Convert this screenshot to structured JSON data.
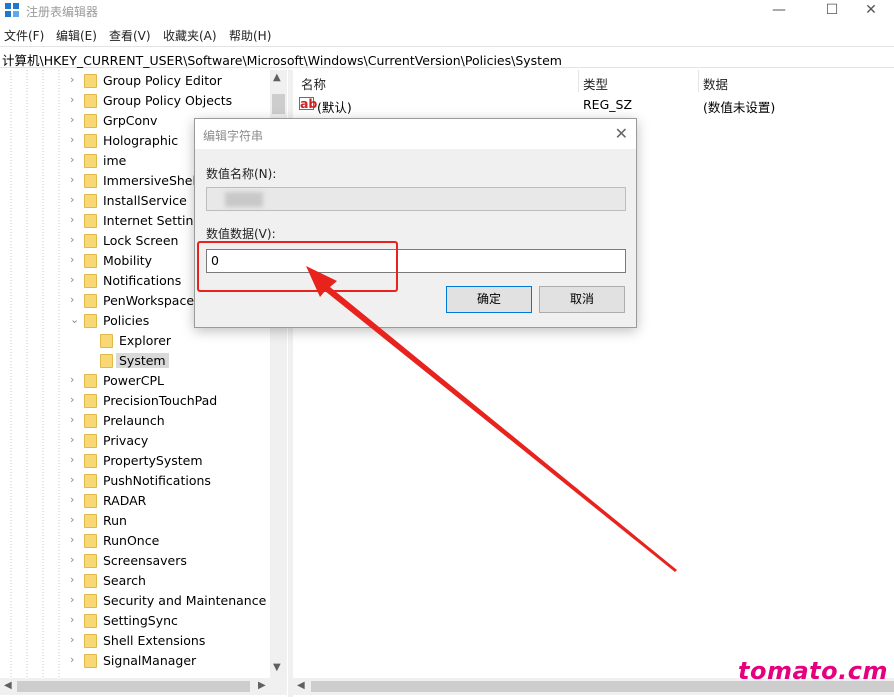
{
  "window": {
    "title": "注册表编辑器",
    "minimize": "—",
    "maximize": "☐",
    "close": "✕"
  },
  "menu": [
    "文件(F)",
    "编辑(E)",
    "查看(V)",
    "收藏夹(A)",
    "帮助(H)"
  ],
  "address": "计算机\\HKEY_CURRENT_USER\\Software\\Microsoft\\Windows\\CurrentVersion\\Policies\\System",
  "tree": {
    "items": [
      {
        "label": "Group Policy Editor",
        "expanded": false
      },
      {
        "label": "Group Policy Objects",
        "expanded": false
      },
      {
        "label": "GrpConv",
        "expanded": false
      },
      {
        "label": "Holographic",
        "expanded": false
      },
      {
        "label": "ime",
        "expanded": false
      },
      {
        "label": "ImmersiveShell",
        "expanded": false
      },
      {
        "label": "InstallService",
        "expanded": false
      },
      {
        "label": "Internet Settings",
        "expanded": false
      },
      {
        "label": "Lock Screen",
        "expanded": false
      },
      {
        "label": "Mobility",
        "expanded": false
      },
      {
        "label": "Notifications",
        "expanded": false
      },
      {
        "label": "PenWorkspace",
        "expanded": false
      },
      {
        "label": "Policies",
        "expanded": true
      },
      {
        "label": "Explorer",
        "child": true
      },
      {
        "label": "System",
        "child": true,
        "selected": true
      },
      {
        "label": "PowerCPL",
        "expanded": false
      },
      {
        "label": "PrecisionTouchPad",
        "expanded": false
      },
      {
        "label": "Prelaunch",
        "expanded": false
      },
      {
        "label": "Privacy",
        "expanded": false
      },
      {
        "label": "PropertySystem",
        "expanded": false
      },
      {
        "label": "PushNotifications",
        "expanded": false
      },
      {
        "label": "RADAR",
        "expanded": false
      },
      {
        "label": "Run",
        "expanded": false
      },
      {
        "label": "RunOnce",
        "expanded": false
      },
      {
        "label": "Screensavers",
        "expanded": false
      },
      {
        "label": "Search",
        "expanded": false
      },
      {
        "label": "Security and Maintenance",
        "expanded": false
      },
      {
        "label": "SettingSync",
        "expanded": false
      },
      {
        "label": "Shell Extensions",
        "expanded": false
      },
      {
        "label": "SignalManager",
        "expanded": false
      }
    ]
  },
  "list": {
    "headers": {
      "name": "名称",
      "type": "类型",
      "data": "数据"
    },
    "rows": [
      {
        "name": "(默认)",
        "type": "REG_SZ",
        "data": "(数值未设置)"
      }
    ],
    "row_icon": "ab"
  },
  "dialog": {
    "title": "编辑字符串",
    "close": "✕",
    "name_label": "数值名称(N):",
    "value_label": "数值数据(V):",
    "value": "0",
    "ok": "确定",
    "cancel": "取消"
  },
  "annotation": {
    "color": "#e8231d"
  },
  "watermark": "tomato.cm"
}
